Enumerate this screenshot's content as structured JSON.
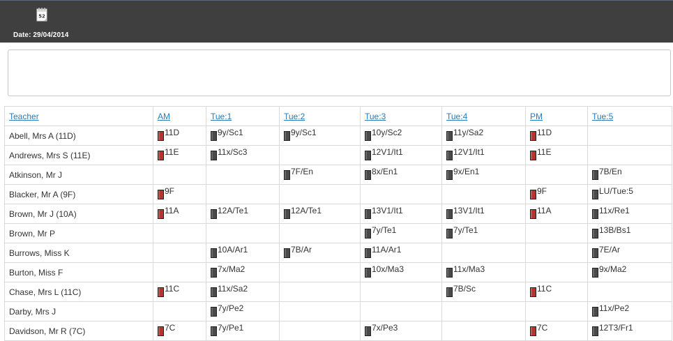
{
  "header": {
    "date_label": "Date: 29/04/2014",
    "calendar_number": "52"
  },
  "colors": {
    "topbar": "#3f3f3f",
    "link": "#2a7ab8",
    "registration_book": "#b83232",
    "lesson_book": "#4a4a4a"
  },
  "columns": [
    "Teacher",
    "AM",
    "Tue:1",
    "Tue:2",
    "Tue:3",
    "Tue:4",
    "PM",
    "Tue:5"
  ],
  "rows": [
    {
      "teacher": "Abell, Mrs A (11D)",
      "cells": [
        {
          "text": "11D",
          "type": "reg"
        },
        {
          "text": "9y/Sc1",
          "type": "lesson"
        },
        {
          "text": "9y/Sc1",
          "type": "lesson"
        },
        {
          "text": "10y/Sc2",
          "type": "lesson"
        },
        {
          "text": "11y/Sa2",
          "type": "lesson"
        },
        {
          "text": "11D",
          "type": "reg"
        },
        null
      ]
    },
    {
      "teacher": "Andrews, Mrs S (11E)",
      "cells": [
        {
          "text": "11E",
          "type": "reg"
        },
        {
          "text": "11x/Sc3",
          "type": "lesson"
        },
        null,
        {
          "text": "12V1/It1",
          "type": "lesson"
        },
        {
          "text": "12V1/It1",
          "type": "lesson"
        },
        {
          "text": "11E",
          "type": "reg"
        },
        null
      ]
    },
    {
      "teacher": "Atkinson, Mr J",
      "cells": [
        null,
        null,
        {
          "text": "7F/En",
          "type": "lesson"
        },
        {
          "text": "8x/En1",
          "type": "lesson"
        },
        {
          "text": "9x/En1",
          "type": "lesson"
        },
        null,
        {
          "text": "7B/En",
          "type": "lesson"
        }
      ]
    },
    {
      "teacher": "Blacker, Mr A (9F)",
      "cells": [
        {
          "text": "9F",
          "type": "reg"
        },
        null,
        null,
        null,
        null,
        {
          "text": "9F",
          "type": "reg"
        },
        {
          "text": "LU/Tue:5",
          "type": "lesson"
        }
      ]
    },
    {
      "teacher": "Brown, Mr J (10A)",
      "cells": [
        {
          "text": "11A",
          "type": "reg"
        },
        {
          "text": "12A/Te1",
          "type": "lesson"
        },
        {
          "text": "12A/Te1",
          "type": "lesson"
        },
        {
          "text": "13V1/It1",
          "type": "lesson"
        },
        {
          "text": "13V1/It1",
          "type": "lesson"
        },
        {
          "text": "11A",
          "type": "reg"
        },
        {
          "text": "11x/Re1",
          "type": "lesson"
        }
      ]
    },
    {
      "teacher": "Brown, Mr P",
      "cells": [
        null,
        null,
        null,
        {
          "text": "7y/Te1",
          "type": "lesson"
        },
        {
          "text": "7y/Te1",
          "type": "lesson"
        },
        null,
        {
          "text": "13B/Bs1",
          "type": "lesson"
        }
      ]
    },
    {
      "teacher": "Burrows, Miss K",
      "cells": [
        null,
        {
          "text": "10A/Ar1",
          "type": "lesson"
        },
        {
          "text": "7B/Ar",
          "type": "lesson"
        },
        {
          "text": "11A/Ar1",
          "type": "lesson"
        },
        null,
        null,
        {
          "text": "7E/Ar",
          "type": "lesson"
        }
      ]
    },
    {
      "teacher": "Burton, Miss F",
      "cells": [
        null,
        {
          "text": "7x/Ma2",
          "type": "lesson"
        },
        null,
        {
          "text": "10x/Ma3",
          "type": "lesson"
        },
        {
          "text": "11x/Ma3",
          "type": "lesson"
        },
        null,
        {
          "text": "9x/Ma2",
          "type": "lesson"
        }
      ]
    },
    {
      "teacher": "Chase, Mrs L (11C)",
      "cells": [
        {
          "text": "11C",
          "type": "reg"
        },
        {
          "text": "11x/Sa2",
          "type": "lesson"
        },
        null,
        null,
        {
          "text": "7B/Sc",
          "type": "lesson"
        },
        {
          "text": "11C",
          "type": "reg"
        },
        null
      ]
    },
    {
      "teacher": "Darby, Mrs J",
      "cells": [
        null,
        {
          "text": "7y/Pe2",
          "type": "lesson"
        },
        null,
        null,
        null,
        null,
        {
          "text": "11x/Pe2",
          "type": "lesson"
        }
      ]
    },
    {
      "teacher": "Davidson, Mr R (7C)",
      "cells": [
        {
          "text": "7C",
          "type": "reg"
        },
        {
          "text": "7y/Pe1",
          "type": "lesson"
        },
        null,
        {
          "text": "7x/Pe3",
          "type": "lesson"
        },
        null,
        {
          "text": "7C",
          "type": "reg"
        },
        {
          "text": "12T3/Fr1",
          "type": "lesson"
        }
      ]
    }
  ]
}
